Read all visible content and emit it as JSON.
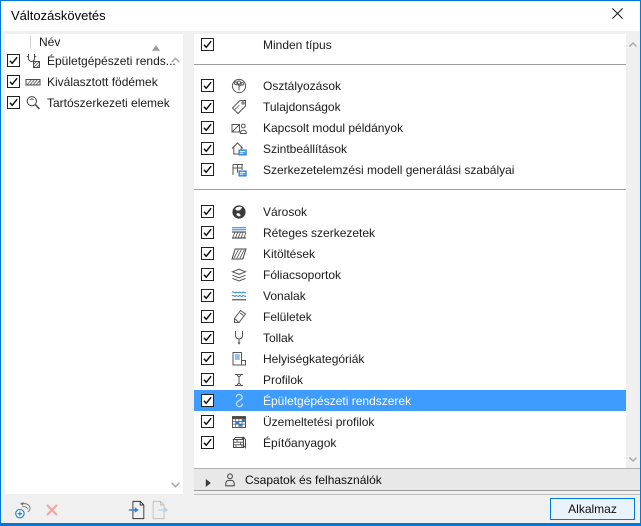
{
  "window": {
    "title": "Változáskövetés"
  },
  "left_panel": {
    "header": {
      "name_column": "Név",
      "sort_icon": "sort-ascending"
    },
    "items": [
      {
        "label": "Épületgépészeti rends...",
        "checked": true,
        "icon": "mep-duct"
      },
      {
        "label": "Kiválasztott födémek",
        "checked": true,
        "icon": "selected-slabs"
      },
      {
        "label": "Tartószerkezeti elemek",
        "checked": true,
        "icon": "structural-elements"
      }
    ]
  },
  "right_panel": {
    "all_types": {
      "label": "Minden típus",
      "checked": true
    },
    "groups": [
      {
        "items": [
          {
            "label": "Osztályozások",
            "icon": "classifications",
            "checked": true
          },
          {
            "label": "Tulajdonságok",
            "icon": "properties",
            "checked": true
          },
          {
            "label": "Kapcsolt modul példányok",
            "icon": "hotlink-modules",
            "checked": true
          },
          {
            "label": "Szintbeállítások",
            "icon": "story-settings",
            "checked": true
          },
          {
            "label": "Szerkezetelemzési modell generálási szabályai",
            "icon": "structural-analysis",
            "checked": true
          }
        ]
      },
      {
        "items": [
          {
            "label": "Városok",
            "icon": "cities",
            "checked": true
          },
          {
            "label": "Réteges szerkezetek",
            "icon": "composites",
            "checked": true
          },
          {
            "label": "Kitöltések",
            "icon": "fills",
            "checked": true
          },
          {
            "label": "Fóliacsoportok",
            "icon": "layer-combinations",
            "checked": true
          },
          {
            "label": "Vonalak",
            "icon": "line-types",
            "checked": true
          },
          {
            "label": "Felületek",
            "icon": "surfaces",
            "checked": true
          },
          {
            "label": "Tollak",
            "icon": "pens",
            "checked": true
          },
          {
            "label": "Helyiségkategóriák",
            "icon": "zone-categories",
            "checked": true
          },
          {
            "label": "Profilok",
            "icon": "profiles",
            "checked": true
          },
          {
            "label": "Épületgépészeti rendszerek",
            "icon": "mep-pipe",
            "checked": true,
            "selected": true
          },
          {
            "label": "Üzemeltetési profilok",
            "icon": "operation-profiles",
            "checked": true
          },
          {
            "label": "Építőanyagok",
            "icon": "building-materials",
            "checked": true
          }
        ]
      }
    ],
    "teams_section": {
      "label": "Csapatok és felhasználók",
      "collapsed": true,
      "icon": "person"
    }
  },
  "toolbar": {
    "buttons": [
      {
        "name": "new-change",
        "icon": "new-change",
        "enabled": true
      },
      {
        "name": "delete",
        "icon": "delete-x",
        "enabled": false
      },
      {
        "name": "import",
        "icon": "import-file",
        "enabled": true
      },
      {
        "name": "export",
        "icon": "export-file",
        "enabled": false
      }
    ]
  },
  "footer": {
    "apply_label": "Alkalmaz"
  },
  "colors": {
    "accent": "#0078d7",
    "selection": "#3e9cff",
    "dialog_bg": "#f0f0f0"
  }
}
